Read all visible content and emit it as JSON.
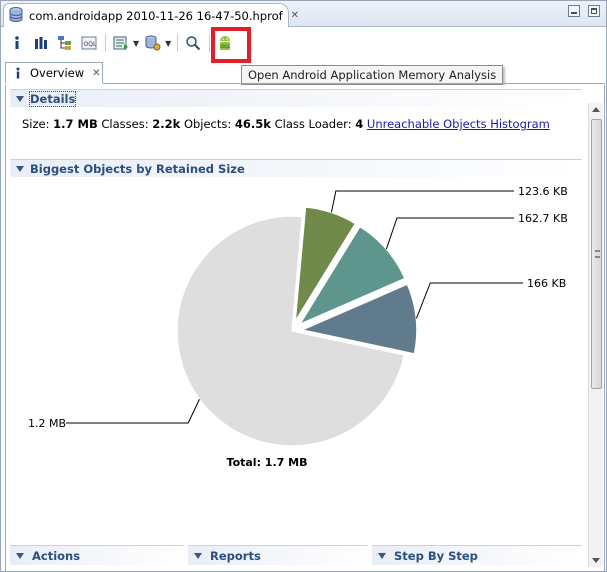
{
  "editor_tab": {
    "title": "com.androidapp 2010-11-26 16-47-50.hprof",
    "close_glyph": "✕"
  },
  "toolbar": {
    "buttons": [
      "info-icon",
      "histogram-icon",
      "dominator-tree-icon",
      "oql-icon",
      "query-browser-icon",
      "heap-dump-overview-icon",
      "search-icon",
      "android-oql-icon"
    ],
    "tooltip": "Open Android Application Memory Analysis",
    "highlight_color": "#e01f26"
  },
  "view_tab": {
    "label": "Overview",
    "close_glyph": "✕"
  },
  "details": {
    "title": "Details",
    "size_label": "Size:",
    "size_value": "1.7 MB",
    "classes_label": "Classes:",
    "classes_value": "2.2k",
    "objects_label": "Objects:",
    "objects_value": "46.5k",
    "loader_label": "Class Loader:",
    "loader_value": "4",
    "unreachable_link": "Unreachable Objects Histogram"
  },
  "biggest_objects": {
    "title": "Biggest Objects by Retained Size"
  },
  "chart_data": {
    "type": "pie",
    "slices": [
      {
        "label": "123.6 KB",
        "value": 123.6,
        "unit": "KB",
        "color": "#6f8a4a"
      },
      {
        "label": "162.7 KB",
        "value": 162.7,
        "unit": "KB",
        "color": "#5e968e"
      },
      {
        "label": "166 KB",
        "value": 166.0,
        "unit": "KB",
        "color": "#607b8c"
      },
      {
        "label": "1.2 MB",
        "value": 1228.8,
        "unit": "KB",
        "color": "#dedede"
      }
    ],
    "total_label": "Total: 1.7 MB"
  },
  "bottom_sections": [
    {
      "label": "Actions"
    },
    {
      "label": "Reports"
    },
    {
      "label": "Step By Step"
    }
  ]
}
